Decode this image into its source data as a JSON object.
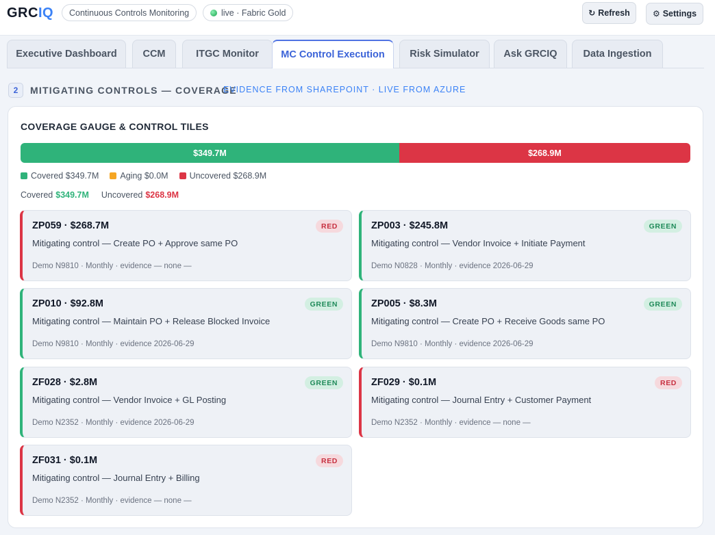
{
  "header": {
    "logo_main": "GRC",
    "logo_accent": "IQ",
    "pill_ccm": "Continuous Controls Monitoring",
    "pill_live": "live · Fabric Gold",
    "refresh_label": "Refresh",
    "refresh_icon": "↻",
    "settings_label": "Settings",
    "settings_icon": "⚙"
  },
  "tabs": [
    {
      "label": "Executive Dashboard"
    },
    {
      "label": "CCM"
    },
    {
      "label": "ITGC Monitor"
    },
    {
      "label": "MC Control Execution",
      "active": true
    },
    {
      "label": "Risk Simulator"
    },
    {
      "label": "Ask GRCIQ"
    },
    {
      "label": "Data Ingestion"
    }
  ],
  "section": {
    "number": "2",
    "title": "MITIGATING CONTROLS — COVERAGE",
    "subtitle": "EVIDENCE FROM SHAREPOINT · LIVE FROM AZURE"
  },
  "card": {
    "title": "COVERAGE GAUGE & CONTROL TILES",
    "gauge": {
      "covered_value": 349.7,
      "uncovered_value": 268.9,
      "covered_label": "$349.7M",
      "uncovered_label": "$268.9M",
      "covered_color": "#2fb37a",
      "uncovered_color": "#dc3545"
    },
    "legend": [
      {
        "label": "Covered $349.7M",
        "color": "#2fb37a"
      },
      {
        "label": "Aging $0.0M",
        "color": "#f5a623"
      },
      {
        "label": "Uncovered $268.9M",
        "color": "#dc3545"
      }
    ],
    "totals": {
      "covered_text": "Covered",
      "covered_value": "$349.7M",
      "uncovered_text": "Uncovered",
      "uncovered_value": "$268.9M"
    }
  },
  "tiles": [
    {
      "id": "ZP059 · $268.7M",
      "status": "RED",
      "desc": "Mitigating control — Create PO + Approve same PO",
      "meta": "Demo N9810 · Monthly · evidence — none —"
    },
    {
      "id": "ZP003 · $245.8M",
      "status": "GREEN",
      "desc": "Mitigating control — Vendor Invoice + Initiate Payment",
      "meta": "Demo N0828 · Monthly · evidence 2026-06-29"
    },
    {
      "id": "ZP010 · $92.8M",
      "status": "GREEN",
      "desc": "Mitigating control — Maintain PO + Release Blocked Invoice",
      "meta": "Demo N9810 · Monthly · evidence 2026-06-29"
    },
    {
      "id": "ZP005 · $8.3M",
      "status": "GREEN",
      "desc": "Mitigating control — Create PO + Receive Goods same PO",
      "meta": "Demo N9810 · Monthly · evidence 2026-06-29"
    },
    {
      "id": "ZF028 · $2.8M",
      "status": "GREEN",
      "desc": "Mitigating control — Vendor Invoice + GL Posting",
      "meta": "Demo N2352 · Monthly · evidence 2026-06-29"
    },
    {
      "id": "ZF029 · $0.1M",
      "status": "RED",
      "desc": "Mitigating control — Journal Entry + Customer Payment",
      "meta": "Demo N2352 · Monthly · evidence — none —"
    },
    {
      "id": "ZF031 · $0.1M",
      "status": "RED",
      "desc": "Mitigating control — Journal Entry + Billing",
      "meta": "Demo N2352 · Monthly · evidence — none —"
    }
  ]
}
